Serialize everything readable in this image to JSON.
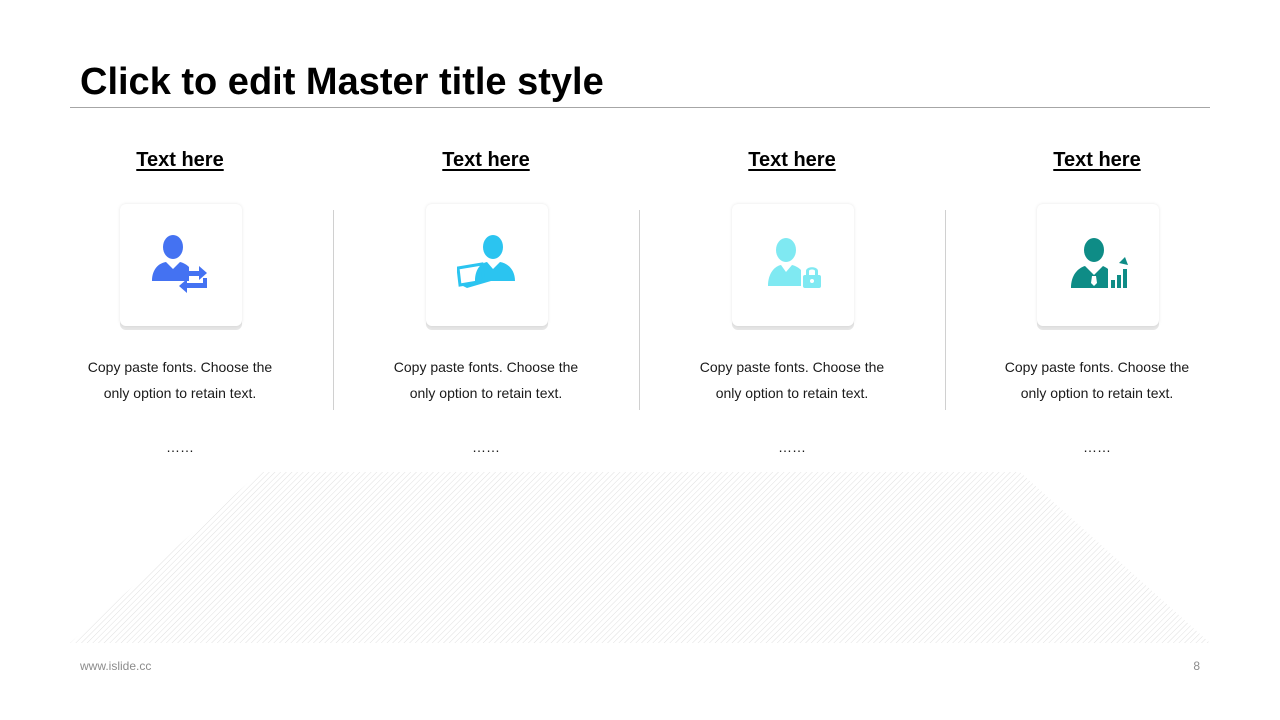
{
  "slide": {
    "title": "Click to edit Master title style"
  },
  "columns": [
    {
      "heading": "Text here",
      "body_line1": "Copy paste fonts. Choose the",
      "body_line2": "only option to retain text.",
      "ellipsis": "……",
      "icon": "user-sync-icon",
      "icon_color": "#4472F2"
    },
    {
      "heading": "Text here",
      "body_line1": "Copy paste fonts. Choose the",
      "body_line2": "only option to retain text.",
      "ellipsis": "……",
      "icon": "user-laptop-icon",
      "icon_color": "#2BC4F0"
    },
    {
      "heading": "Text here",
      "body_line1": "Copy paste fonts. Choose the",
      "body_line2": "only option to retain text.",
      "ellipsis": "……",
      "icon": "user-lock-icon",
      "icon_color": "#7FE9F2"
    },
    {
      "heading": "Text here",
      "body_line1": "Copy paste fonts. Choose the",
      "body_line2": "only option to retain text.",
      "ellipsis": "……",
      "icon": "user-growth-chart-icon",
      "icon_color": "#0E8C86"
    }
  ],
  "footer": {
    "url": "www.islide.cc",
    "page_number": "8"
  },
  "colors": {
    "floor_hatch": "#d9d9d9",
    "rule": "#a6a6a6"
  }
}
